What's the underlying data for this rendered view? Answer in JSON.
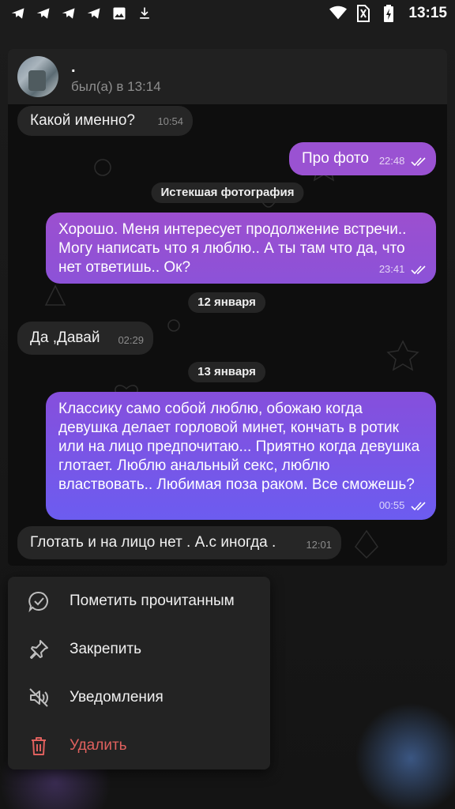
{
  "status_bar": {
    "time": "13:15",
    "left_icons": [
      "telegram-icon",
      "telegram-icon",
      "telegram-icon",
      "telegram-icon",
      "image-icon",
      "download-icon"
    ],
    "right_icons": [
      "wifi-icon",
      "no-sim-icon",
      "battery-charging-icon"
    ]
  },
  "chat": {
    "name": ".",
    "last_seen": "был(а) в 13:14"
  },
  "messages": [
    {
      "dir": "in",
      "text": "Какой именно?",
      "time": "10:54"
    },
    {
      "dir": "out",
      "text": "Про фото",
      "time": "22:48"
    },
    {
      "dir": "service",
      "text": "Истекшая фотография"
    },
    {
      "dir": "out",
      "text": "Хорошо. Меня интересует продолжение встречи.. Могу написать что я люблю.. А ты там что да, что нет ответишь.. Ок?",
      "time": "23:41"
    },
    {
      "dir": "service",
      "text": "12 января"
    },
    {
      "dir": "in",
      "text": "Да ,Давай",
      "time": "02:29"
    },
    {
      "dir": "service",
      "text": "13 января"
    },
    {
      "dir": "out",
      "text": "Классику само собой люблю, обожаю когда девушка делает горловой минет, кончать в ротик или на лицо предпочитаю... Приятно когда девушка глотает. Люблю анальный секс, люблю властвовать.. Любимая поза раком. Все сможешь?",
      "time": "00:55"
    },
    {
      "dir": "in",
      "text": "Глотать и на лицо нет . А.с иногда .",
      "time": "12:01"
    }
  ],
  "menu": {
    "items": [
      {
        "label": "Пометить прочитанным",
        "icon": "read-check-icon"
      },
      {
        "label": "Закрепить",
        "icon": "pin-icon"
      },
      {
        "label": "Уведомления",
        "icon": "mute-bell-icon"
      },
      {
        "label": "Удалить",
        "icon": "trash-icon"
      }
    ]
  },
  "colors": {
    "accent_out_top": "#9b4fd0",
    "accent_out_bottom": "#6c5cf0",
    "danger": "#e0615e",
    "incoming_bubble": "#262626"
  }
}
